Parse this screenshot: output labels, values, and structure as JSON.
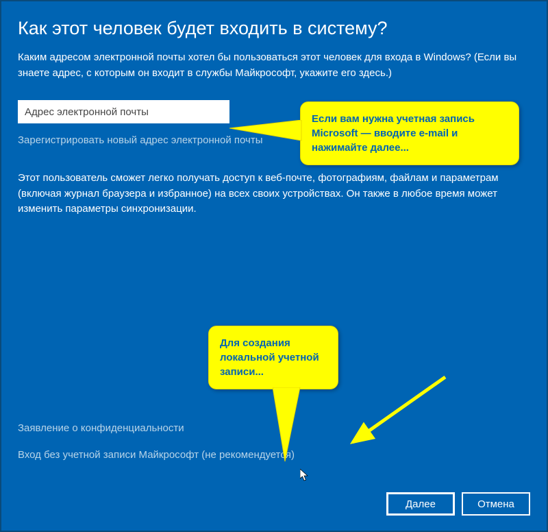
{
  "colors": {
    "background": "#0064b3",
    "callout": "#ffff00",
    "callout_text": "#0064b3"
  },
  "header": {
    "title": "Как этот человек будет входить в систему?",
    "description": "Каким адресом электронной почты хотел бы пользоваться этот человек для входа в Windows? (Если вы знаете адрес, с которым он входит в службы Майкрософт, укажите его здесь.)"
  },
  "form": {
    "email_placeholder": "Адрес электронной почты",
    "register_link": "Зарегистрировать новый адрес электронной почты",
    "info_text": "Этот пользователь сможет легко получать доступ к веб-почте, фотографиям, файлам и параметрам (включая журнал браузера и избранное) на всех своих устройствах. Он также в любое время может изменить параметры синхронизации."
  },
  "links": {
    "privacy": "Заявление о конфиденциальности",
    "no_account": "Вход без учетной записи Майкрософт (не рекомендуется)"
  },
  "buttons": {
    "next": "Далее",
    "cancel": "Отмена"
  },
  "annotations": {
    "callout1": "Если вам нужна учетная запись Microsoft — вводите e-mail и нажимайте далее...",
    "callout2": "Для создания локальной учетной записи..."
  }
}
